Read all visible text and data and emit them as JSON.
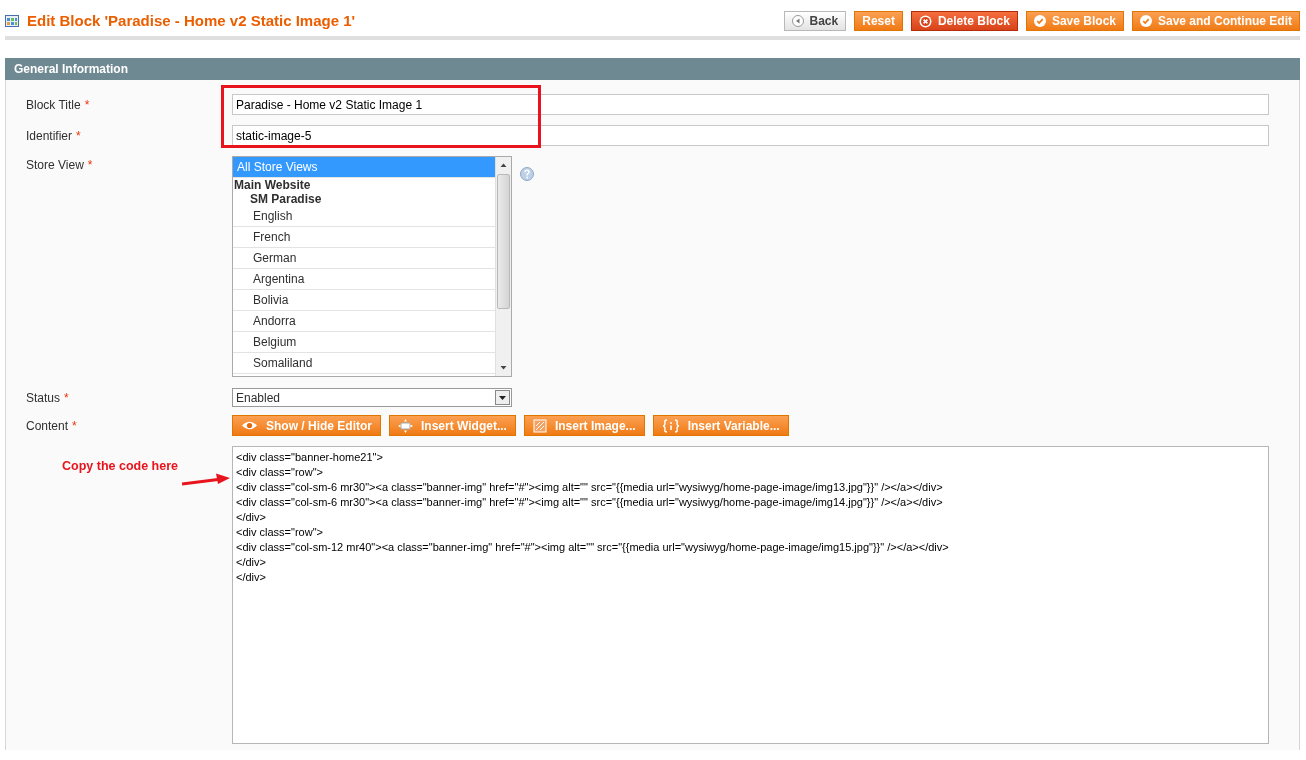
{
  "page_title": "Edit Block 'Paradise - Home v2 Static Image 1'",
  "header_buttons": [
    {
      "label": "Back",
      "kind": "back"
    },
    {
      "label": "Reset",
      "kind": "plain"
    },
    {
      "label": "Delete Block",
      "kind": "delete"
    },
    {
      "label": "Save Block",
      "kind": "save"
    },
    {
      "label": "Save and Continue Edit",
      "kind": "save"
    }
  ],
  "section_title": "General Information",
  "fields": {
    "block_title": {
      "label": "Block Title",
      "required_mark": "*",
      "value": "Paradise - Home v2 Static Image 1"
    },
    "identifier": {
      "label": "Identifier",
      "required_mark": "*",
      "value": "static-image-5"
    },
    "store_view": {
      "label": "Store View",
      "required_mark": "*",
      "options": [
        {
          "label": "All Store Views",
          "selected": true
        },
        {
          "label": "Main Website",
          "selected": false,
          "children": [
            {
              "label": "SM Paradise",
              "selected": false,
              "children": [
                {
                  "label": "English",
                  "selected": false
                },
                {
                  "label": "French",
                  "selected": false
                },
                {
                  "label": "German",
                  "selected": false
                },
                {
                  "label": "Argentina",
                  "selected": false
                },
                {
                  "label": "Bolivia",
                  "selected": false
                },
                {
                  "label": "Andorra",
                  "selected": false
                },
                {
                  "label": "Belgium",
                  "selected": false
                },
                {
                  "label": "Somaliland",
                  "selected": false
                }
              ]
            }
          ]
        }
      ]
    },
    "status": {
      "label": "Status",
      "required_mark": "*",
      "value": "Enabled"
    },
    "content": {
      "label": "Content",
      "required_mark": "*",
      "buttons": [
        {
          "label": "Show / Hide Editor",
          "kind": "eye"
        },
        {
          "label": "Insert Widget...",
          "kind": "widget"
        },
        {
          "label": "Insert Image...",
          "kind": "image"
        },
        {
          "label": "Insert Variable...",
          "kind": "variable"
        }
      ],
      "lines": [
        "<div class=\"banner-home21\">",
        "<div class=\"row\">",
        "<div class=\"col-sm-6 mr30\"><a class=\"banner-img\" href=\"#\"><img alt=\"\" src=\"{{media url=\"wysiwyg/home-page-image/img13.jpg\"}}\" /></a></div>",
        "<div class=\"col-sm-6 mr30\"><a class=\"banner-img\" href=\"#\"><img alt=\"\" src=\"{{media url=\"wysiwyg/home-page-image/img14.jpg\"}}\" /></a></div>",
        "</div>",
        "<div class=\"row\">",
        "<div class=\"col-sm-12 mr40\"><a class=\"banner-img\" href=\"#\"><img alt=\"\" src=\"{{media url=\"wysiwyg/home-page-image/img15.jpg\"}}\" /></a></div>",
        "</div>",
        "</div>"
      ]
    }
  },
  "annotation": {
    "text": "Copy the code here"
  }
}
